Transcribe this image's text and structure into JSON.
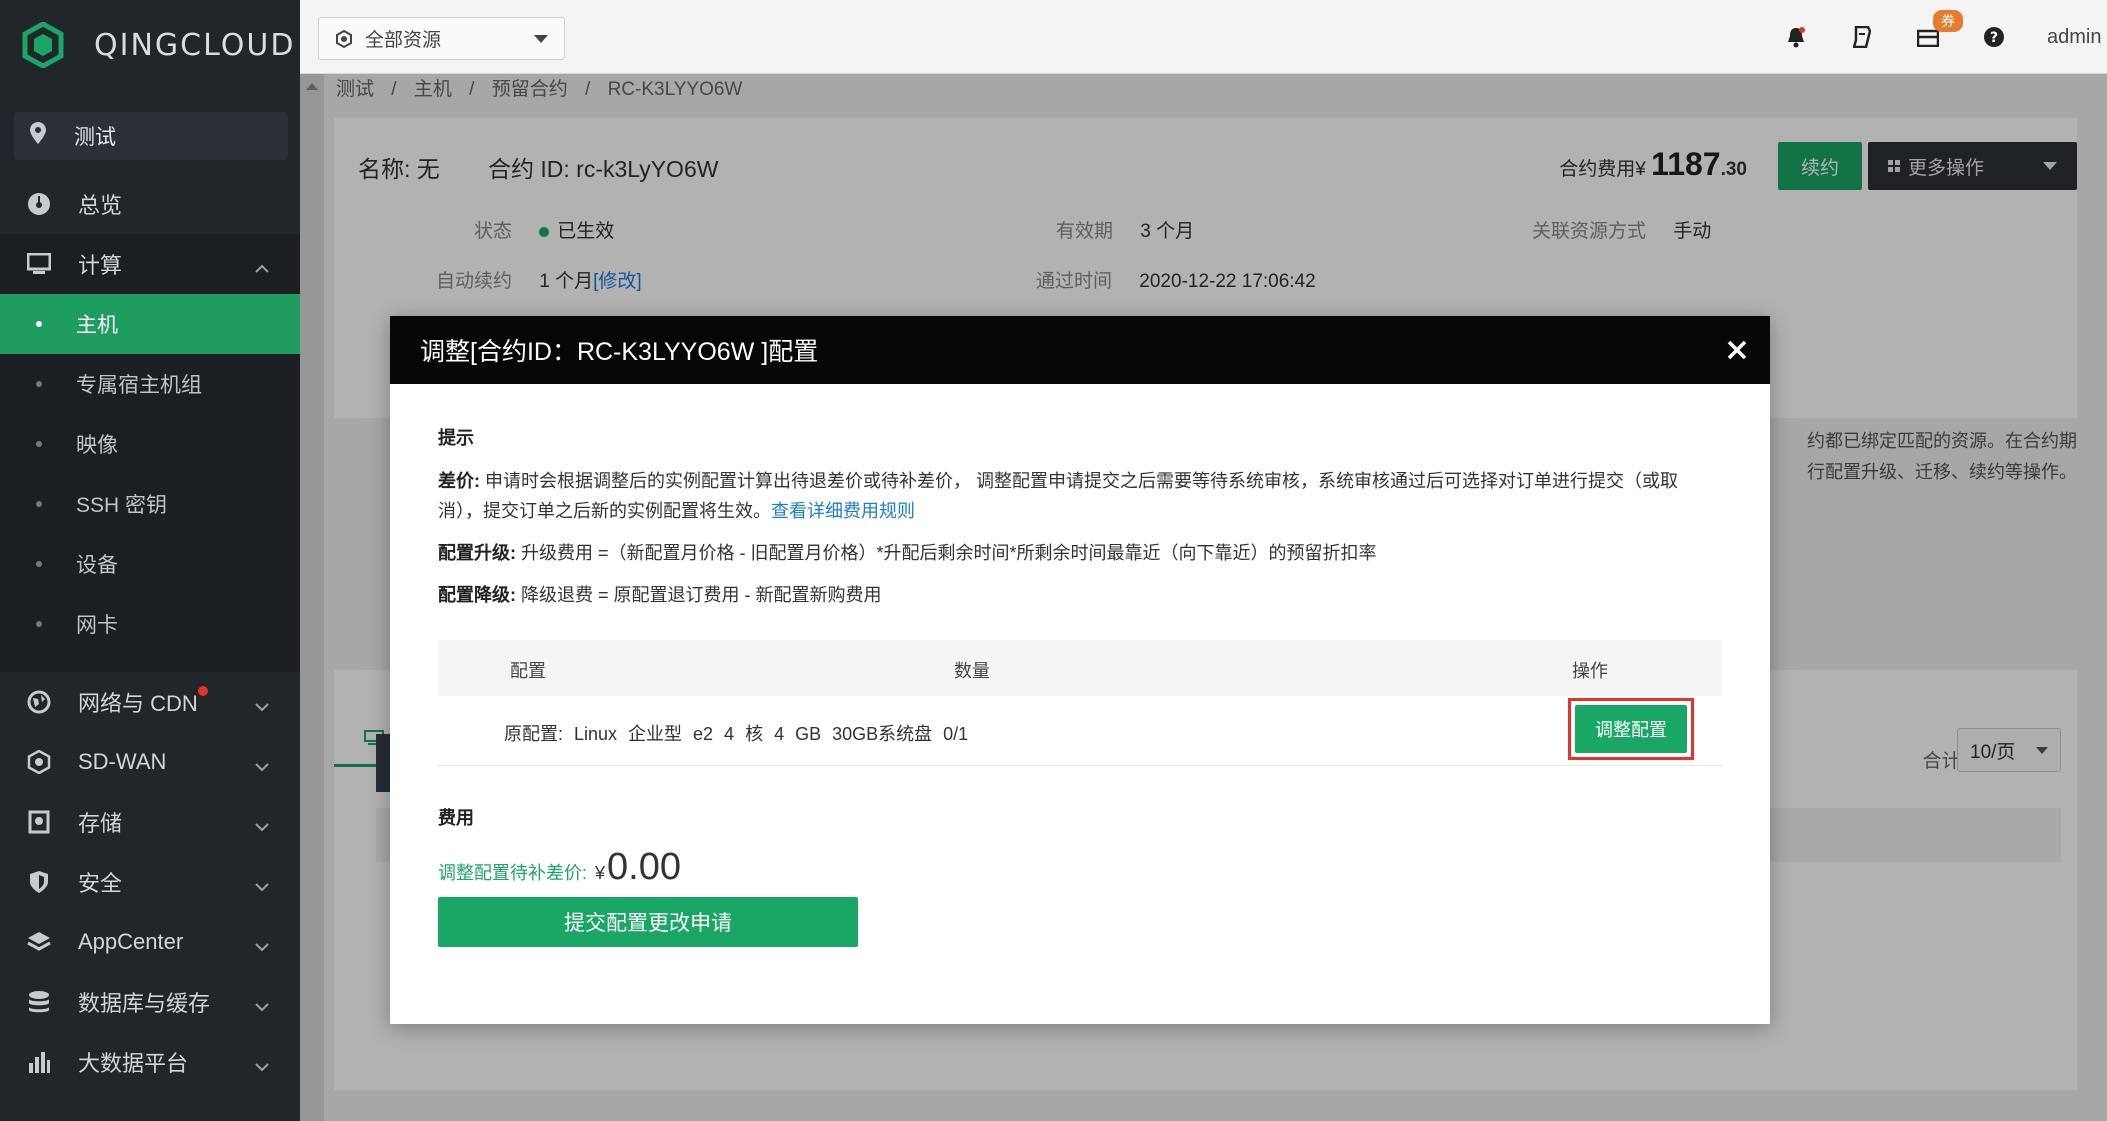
{
  "brand": {
    "name": "QINGCLOUD"
  },
  "sidebar": {
    "project": "测试",
    "items": [
      {
        "label": "总览",
        "icon": "dashboard-icon"
      },
      {
        "label": "计算",
        "icon": "monitor-icon"
      }
    ],
    "compute_sub": [
      "主机",
      "专属宿主机组",
      "映像",
      "SSH 密钥",
      "设备",
      "网卡"
    ],
    "groups": [
      {
        "label": "网络与 CDN",
        "icon": "globe-icon"
      },
      {
        "label": "SD-WAN",
        "icon": "sdwan-icon"
      },
      {
        "label": "存储",
        "icon": "storage-icon"
      },
      {
        "label": "安全",
        "icon": "shield-icon"
      },
      {
        "label": "AppCenter",
        "icon": "layers-icon"
      },
      {
        "label": "数据库与缓存",
        "icon": "database-icon"
      },
      {
        "label": "大数据平台",
        "icon": "chart-icon"
      }
    ]
  },
  "topbar": {
    "resource_select": "全部资源",
    "coupon_badge": "券",
    "user": "admin"
  },
  "breadcrumb": [
    "测试",
    "/",
    "主机",
    "/",
    "预留合约",
    "/",
    "RC-K3LYYO6W"
  ],
  "contract": {
    "name": "名称: 无",
    "id_label": "合约 ID: rc-k3LyYO6W",
    "fee_label": "合约费用¥",
    "fee_int": "1187",
    "fee_dec": ".30",
    "renew_btn": "续约",
    "more_btn": "更多操作",
    "status_label": "状态",
    "status_value": "已生效",
    "validity_label": "有效期",
    "validity_value": "3 个月",
    "assoc_label": "关联资源方式",
    "assoc_value": "手动",
    "auto_label": "自动续约",
    "auto_value": "1 个月",
    "auto_link": "[修改]",
    "passed_label": "通过时间",
    "passed_value": "2020-12-22 17:06:42",
    "right_note": "约都已绑定匹配的资源。在合约期行配置升级、迁移、续约等操作。",
    "total": "合计 : 0",
    "page_size": "10/页"
  },
  "modal": {
    "title": "调整[合约ID：RC-K3LYYO6W ]配置",
    "tip_title": "提示",
    "tip1_bold": "差价:",
    "tip1_text": " 申请时会根据调整后的实例配置计算出待退差价或待补差价， 调整配置申请提交之后需要等待系统审核，系统审核通过后可选择对订单进行提交（或取消），提交订单之后新的实例配置将生效。",
    "tip1_link": "查看详细费用规则",
    "tip2_bold": "配置升级:",
    "tip2_text": " 升级费用 =（新配置月价格 - 旧配置月价格）*升配后剩余时间*所剩余时间最靠近（向下靠近）的预留折扣率",
    "tip3_bold": "配置降级:",
    "tip3_text": " 降级退费 = 原配置退订费用 - 新配置新购费用",
    "table": {
      "headers": [
        "配置",
        "数量",
        "操作"
      ],
      "row": "原配置:  Linux  企业型 e2  4 核  4 GB  30GB系统盘  0/1",
      "action": "调整配置"
    },
    "fee_title": "费用",
    "diff_label": "调整配置待补差价:",
    "currency": "¥",
    "amount": "0.00",
    "submit": "提交配置更改申请"
  },
  "colors": {
    "accent": "#1aa765",
    "sidebar_bg": "#21262b",
    "highlight": "#e5332a"
  }
}
